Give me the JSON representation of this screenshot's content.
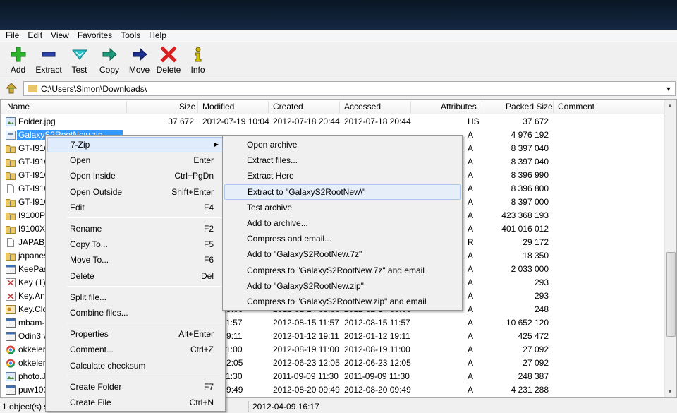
{
  "menubar": [
    "File",
    "Edit",
    "View",
    "Favorites",
    "Tools",
    "Help"
  ],
  "toolbar": [
    {
      "label": "Add",
      "icon": "plus-icon"
    },
    {
      "label": "Extract",
      "icon": "minus-icon"
    },
    {
      "label": "Test",
      "icon": "check-icon"
    },
    {
      "label": "Copy",
      "icon": "arrow-right-green-icon"
    },
    {
      "label": "Move",
      "icon": "arrow-right-blue-icon"
    },
    {
      "label": "Delete",
      "icon": "delete-x-icon"
    },
    {
      "label": "Info",
      "icon": "info-icon"
    }
  ],
  "address": {
    "path": "C:\\Users\\Simon\\Downloads\\"
  },
  "columns": {
    "name": "Name",
    "size": "Size",
    "modified": "Modified",
    "created": "Created",
    "accessed": "Accessed",
    "attributes": "Attributes",
    "packed": "Packed Size",
    "comment": "Comment"
  },
  "files": [
    {
      "name": "Folder.jpg",
      "size": "37 672",
      "modified": "2012-07-19 10:04",
      "created": "2012-07-18 20:44",
      "accessed": "2012-07-18 20:44",
      "attr": "HS",
      "packed": "37 672",
      "icon": "image"
    },
    {
      "name": "GalaxyS2RootNew.zip",
      "size": "",
      "modified": "",
      "created": "",
      "accessed": "",
      "attr": "A",
      "packed": "4 976 192",
      "icon": "archive",
      "selected": true
    },
    {
      "name": "GT-I9100",
      "size": "",
      "modified": "",
      "created": "",
      "accessed": "",
      "attr": "A",
      "packed": "8 397 040",
      "icon": "archive-folder"
    },
    {
      "name": "GT-I9100",
      "size": "",
      "modified": "",
      "created": "",
      "accessed": "",
      "attr": "A",
      "packed": "8 397 040",
      "icon": "archive-folder"
    },
    {
      "name": "GT-I9100",
      "size": "",
      "modified": "",
      "created": "",
      "accessed": "",
      "attr": "A",
      "packed": "8 396 990",
      "icon": "archive-folder"
    },
    {
      "name": "GT-I9100",
      "size": "",
      "modified": "",
      "created": "",
      "accessed": "",
      "attr": "A",
      "packed": "8 396 800",
      "icon": "blank"
    },
    {
      "name": "GT-I9100",
      "size": "",
      "modified": "",
      "created": "",
      "accessed": "",
      "attr": "A",
      "packed": "8 397 000",
      "icon": "archive-folder"
    },
    {
      "name": "I9100PE",
      "size": "",
      "modified": "",
      "created": "",
      "accessed": "",
      "attr": "A",
      "packed": "423 368 193",
      "icon": "archive-folder"
    },
    {
      "name": "I9100XX",
      "size": "",
      "modified": "",
      "created": "",
      "accessed": "",
      "attr": "A",
      "packed": "401 016 012",
      "icon": "archive-folder"
    },
    {
      "name": "JAPAB_",
      "size": "",
      "modified": "",
      "created": "",
      "accessed": "",
      "attr": "R",
      "packed": "29 172",
      "icon": "blank"
    },
    {
      "name": "japanes",
      "size": "",
      "modified": "",
      "created": "",
      "accessed": "",
      "attr": "A",
      "packed": "18 350",
      "icon": "archive-folder"
    },
    {
      "name": "KeePas",
      "size": "",
      "modified": "",
      "created": "",
      "accessed": "",
      "attr": "A",
      "packed": "2 033 000",
      "icon": "app"
    },
    {
      "name": "Key (1).",
      "size": "",
      "modified": "",
      "created": "",
      "accessed": "",
      "attr": "A",
      "packed": "293",
      "icon": "key"
    },
    {
      "name": "Key.Any",
      "size": "",
      "modified": "",
      "created": "",
      "accessed": "",
      "attr": "A",
      "packed": "293",
      "icon": "key"
    },
    {
      "name": "Key.Clo",
      "size": "",
      "modified": "2-14 09:00",
      "created": "2012-02-14 09:00",
      "accessed": "2012-02-14 09:00",
      "attr": "A",
      "packed": "248",
      "icon": "keyfile"
    },
    {
      "name": "mbam-",
      "size": "",
      "modified": "8-15 11:57",
      "created": "2012-08-15 11:57",
      "accessed": "2012-08-15 11:57",
      "attr": "A",
      "packed": "10 652 120",
      "icon": "app"
    },
    {
      "name": "Odin3 v",
      "size": "",
      "modified": "1-12 19:11",
      "created": "2012-01-12 19:11",
      "accessed": "2012-01-12 19:11",
      "attr": "A",
      "packed": "425 472",
      "icon": "app"
    },
    {
      "name": "okkeler",
      "size": "",
      "modified": "8-19 11:00",
      "created": "2012-08-19 11:00",
      "accessed": "2012-08-19 11:00",
      "attr": "A",
      "packed": "27 092",
      "icon": "chrome"
    },
    {
      "name": "okkeler",
      "size": "",
      "modified": "6-23 12:05",
      "created": "2012-06-23 12:05",
      "accessed": "2012-06-23 12:05",
      "attr": "A",
      "packed": "27 092",
      "icon": "chrome"
    },
    {
      "name": "photo.J",
      "size": "",
      "modified": "9-09 11:30",
      "created": "2011-09-09 11:30",
      "accessed": "2011-09-09 11:30",
      "attr": "A",
      "packed": "248 387",
      "icon": "image"
    },
    {
      "name": "puw100",
      "size": "",
      "modified": "8-20 09:49",
      "created": "2012-08-20 09:49",
      "accessed": "2012-08-20 09:49",
      "attr": "A",
      "packed": "4 231 288",
      "icon": "app"
    }
  ],
  "status": {
    "selection": "1 object(s) s",
    "date": "2012-04-09 16:17"
  },
  "context_menu": [
    {
      "label": "7-Zip",
      "shortcut": "",
      "submenu": true,
      "highlighted": true
    },
    {
      "label": "Open",
      "shortcut": "Enter"
    },
    {
      "label": "Open Inside",
      "shortcut": "Ctrl+PgDn"
    },
    {
      "label": "Open Outside",
      "shortcut": "Shift+Enter"
    },
    {
      "label": "Edit",
      "shortcut": "F4"
    },
    {
      "separator": true
    },
    {
      "label": "Rename",
      "shortcut": "F2"
    },
    {
      "label": "Copy To...",
      "shortcut": "F5"
    },
    {
      "label": "Move To...",
      "shortcut": "F6"
    },
    {
      "label": "Delete",
      "shortcut": "Del"
    },
    {
      "separator": true
    },
    {
      "label": "Split file...",
      "shortcut": ""
    },
    {
      "label": "Combine files...",
      "shortcut": ""
    },
    {
      "separator": true
    },
    {
      "label": "Properties",
      "shortcut": "Alt+Enter"
    },
    {
      "label": "Comment...",
      "shortcut": "Ctrl+Z"
    },
    {
      "label": "Calculate checksum",
      "shortcut": ""
    },
    {
      "separator": true
    },
    {
      "label": "Create Folder",
      "shortcut": "F7"
    },
    {
      "label": "Create File",
      "shortcut": "Ctrl+N"
    }
  ],
  "submenu": [
    {
      "label": "Open archive"
    },
    {
      "label": "Extract files..."
    },
    {
      "label": "Extract Here"
    },
    {
      "label": "Extract to \"GalaxyS2RootNew\\\"",
      "highlighted": true
    },
    {
      "label": "Test archive"
    },
    {
      "label": "Add to archive..."
    },
    {
      "label": "Compress and email..."
    },
    {
      "label": "Add to \"GalaxyS2RootNew.7z\""
    },
    {
      "label": "Compress to \"GalaxyS2RootNew.7z\" and email"
    },
    {
      "label": "Add to \"GalaxyS2RootNew.zip\""
    },
    {
      "label": "Compress to \"GalaxyS2RootNew.zip\" and email"
    }
  ],
  "colors": {
    "selection": "#3399ff",
    "menu_bg": "#f0f0f0",
    "highlight": "#e0ecfb"
  }
}
